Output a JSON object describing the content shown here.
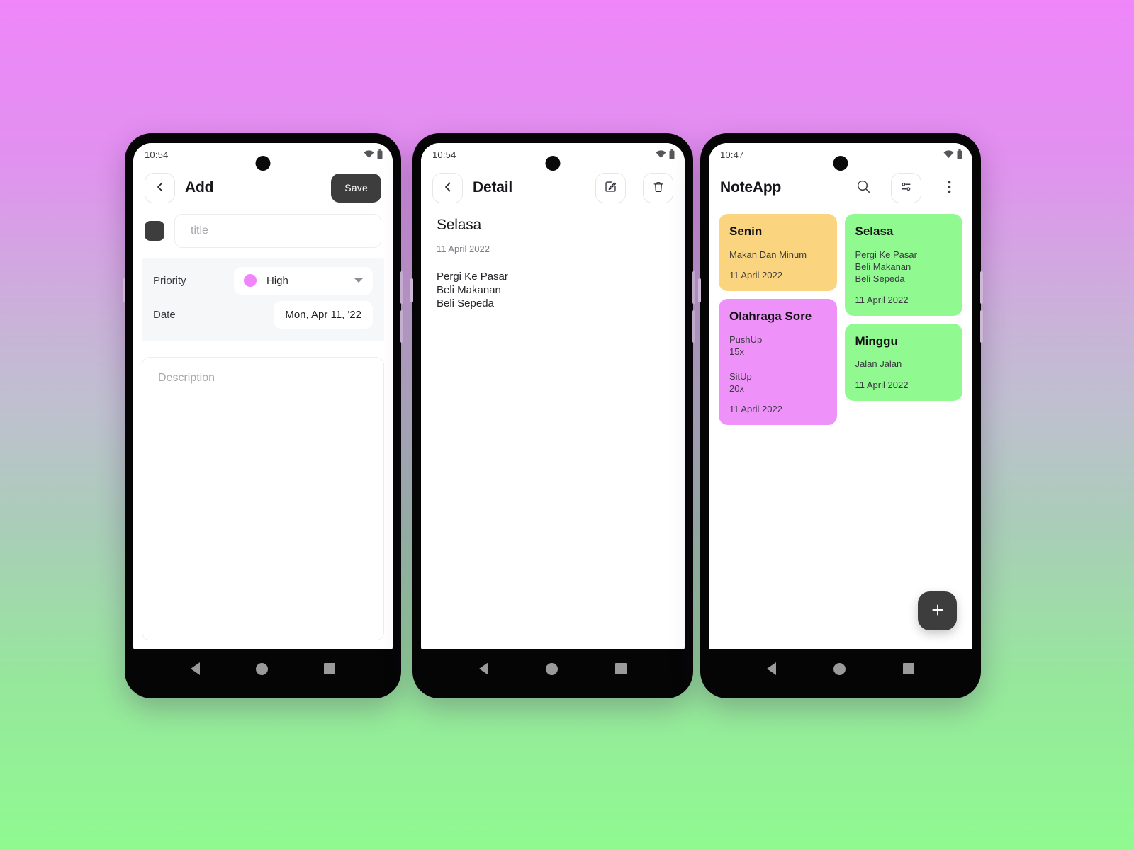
{
  "background": {
    "gradient_top": "#ef86fa",
    "gradient_bottom": "#90fa90"
  },
  "phone_add": {
    "status": {
      "time": "10:54",
      "wifi_icon": "wifi-icon",
      "battery_icon": "battery-icon"
    },
    "appbar": {
      "back_icon": "chevron-left-icon",
      "title": "Add",
      "save_label": "Save"
    },
    "form": {
      "color_swatch": "#3d3d3d",
      "title_placeholder": "title",
      "title_value": "",
      "priority_label": "Priority",
      "priority_value": "High",
      "priority_color": "#ee86fa",
      "date_label": "Date",
      "date_value": "Mon, Apr 11, '22",
      "description_placeholder": "Description",
      "description_value": ""
    },
    "nav": {
      "back": "nav-back-icon",
      "home": "nav-home-icon",
      "recent": "nav-recent-icon"
    }
  },
  "phone_detail": {
    "status": {
      "time": "10:54",
      "wifi_icon": "wifi-icon",
      "battery_icon": "battery-icon"
    },
    "appbar": {
      "back_icon": "chevron-left-icon",
      "title": "Detail",
      "edit_icon": "edit-pencil-icon",
      "delete_icon": "trash-icon"
    },
    "note": {
      "title": "Selasa",
      "date": "11 April 2022",
      "description": "Pergi Ke Pasar\nBeli Makanan\nBeli Sepeda"
    },
    "nav": {
      "back": "nav-back-icon",
      "home": "nav-home-icon",
      "recent": "nav-recent-icon"
    }
  },
  "phone_list": {
    "status": {
      "time": "10:47",
      "wifi_icon": "wifi-icon",
      "battery_icon": "battery-icon"
    },
    "appbar": {
      "title": "NoteApp",
      "search_icon": "search-icon",
      "filter_icon": "sliders-filter-icon",
      "overflow_icon": "more-vertical-icon"
    },
    "notes_left": [
      {
        "title": "Senin",
        "description": "Makan Dan Minum",
        "date": "11 April 2022",
        "color": "#fad47e"
      },
      {
        "title": "Olahraga Sore",
        "description": "PushUp\n15x\n\nSitUp\n20x",
        "date": "11 April 2022",
        "color": "#ee92fa"
      }
    ],
    "notes_right": [
      {
        "title": "Selasa",
        "description": "Pergi Ke Pasar\nBeli Makanan\nBeli Sepeda",
        "date": "11 April 2022",
        "color": "#90fa90"
      },
      {
        "title": "Minggu",
        "description": "Jalan Jalan",
        "date": "11 April 2022",
        "color": "#90fa90"
      }
    ],
    "fab": {
      "icon": "plus-icon",
      "label": "+"
    },
    "nav": {
      "back": "nav-back-icon",
      "home": "nav-home-icon",
      "recent": "nav-recent-icon"
    }
  }
}
